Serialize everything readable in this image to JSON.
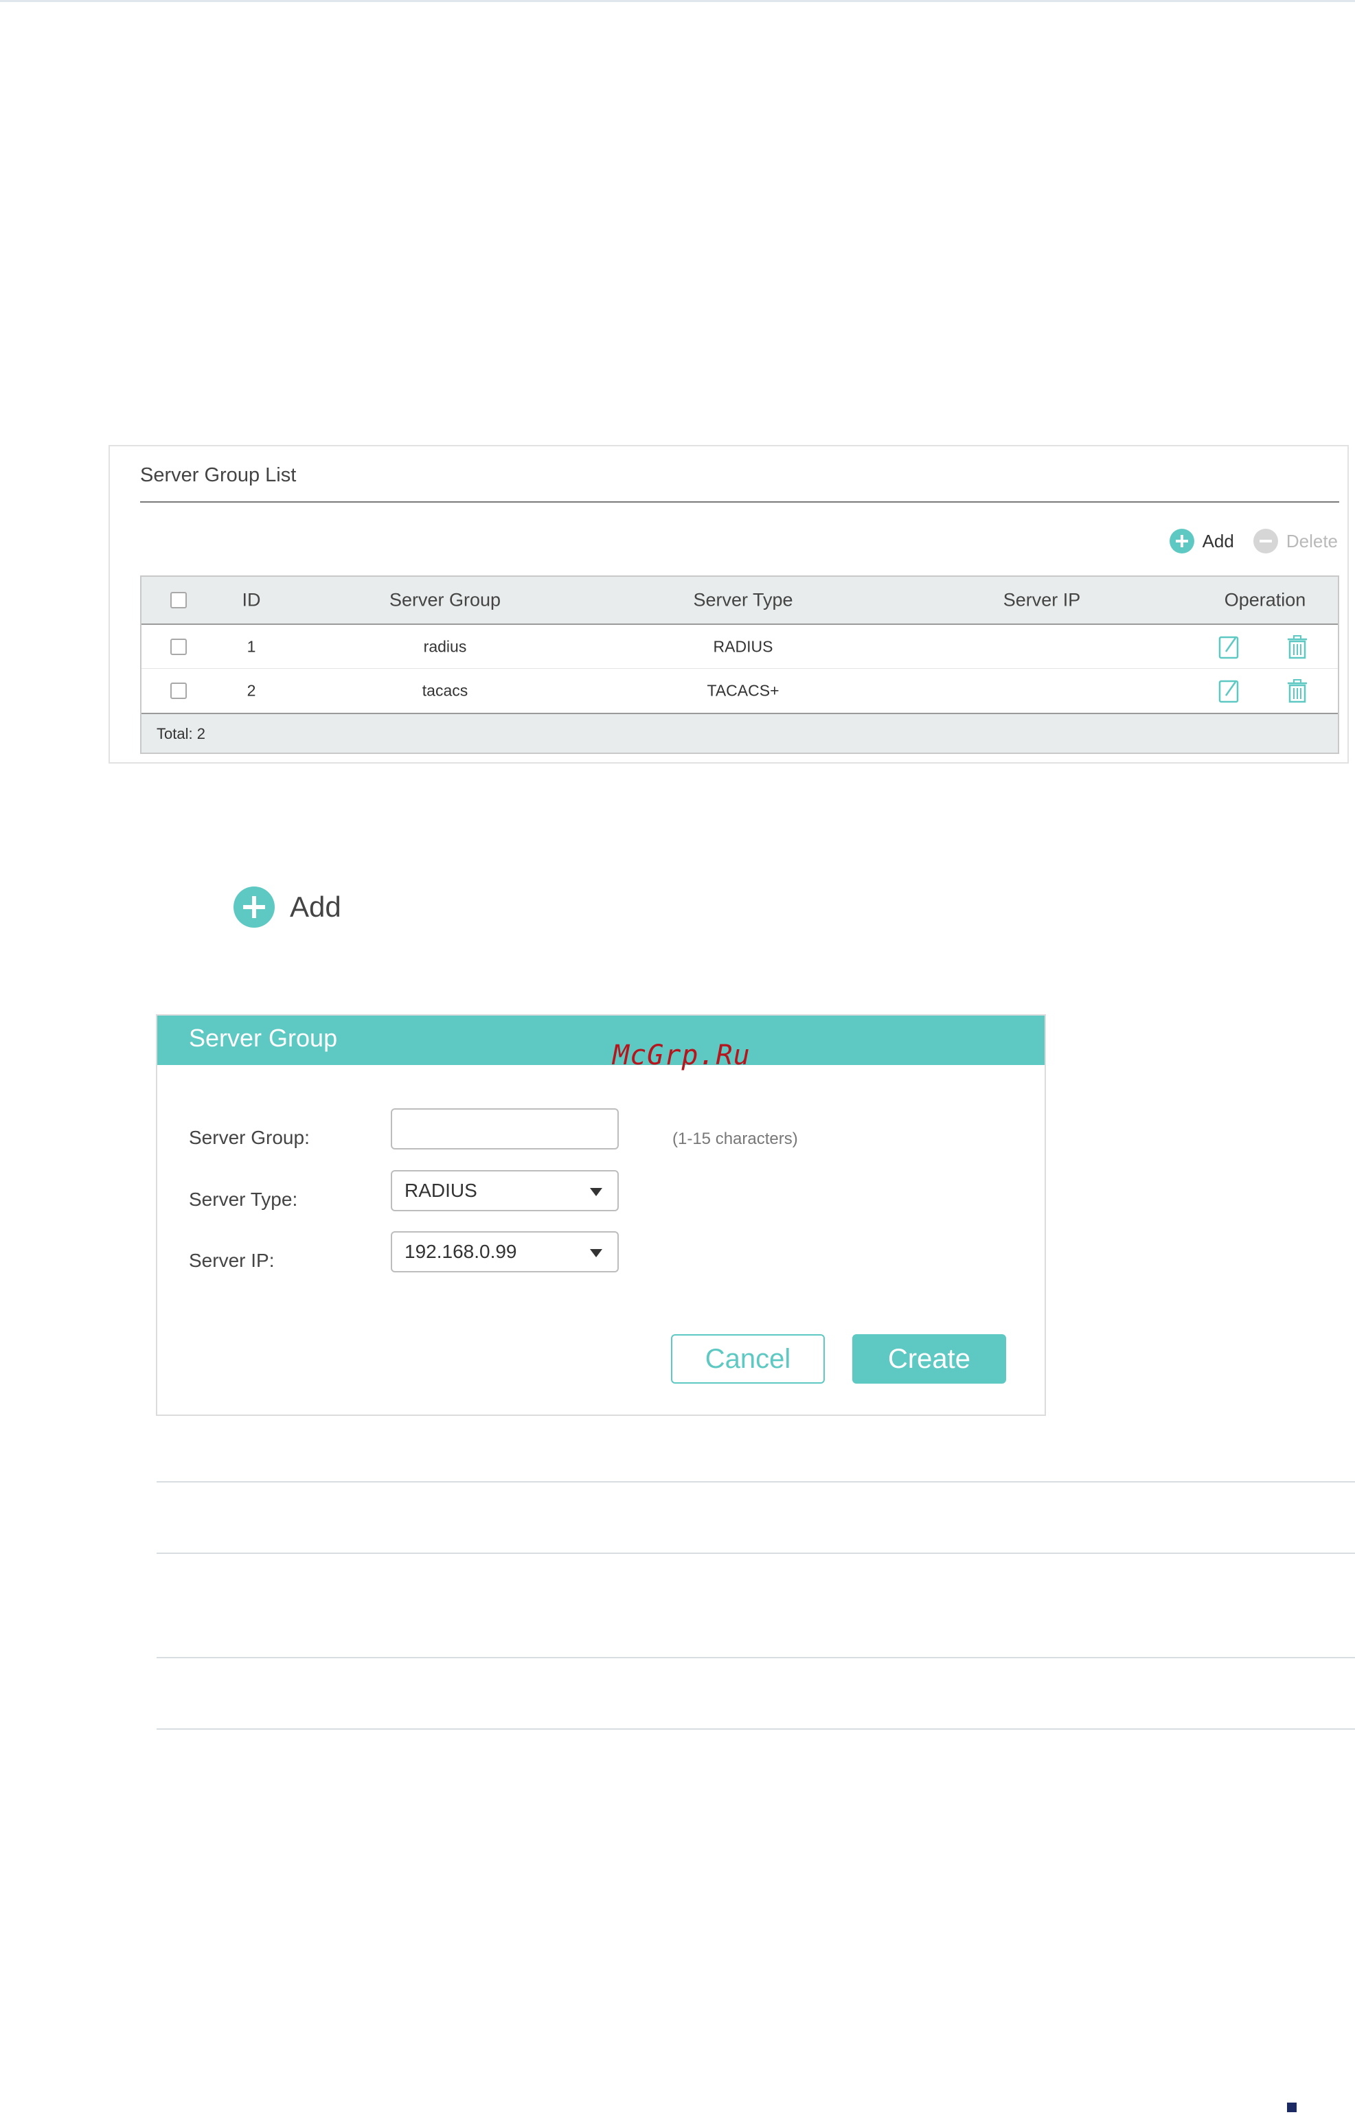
{
  "server_group_list": {
    "title": "Server Group List",
    "toolbar": {
      "add_label": "Add",
      "delete_label": "Delete"
    },
    "columns": [
      "",
      "ID",
      "Server Group",
      "Server Type",
      "Server IP",
      "Operation"
    ],
    "rows": [
      {
        "id": "1",
        "server_group": "radius",
        "server_type": "RADIUS",
        "server_ip": ""
      },
      {
        "id": "2",
        "server_group": "tacacs",
        "server_type": "TACACS+",
        "server_ip": ""
      }
    ],
    "footer": "Total: 2"
  },
  "add_button": {
    "label": "Add"
  },
  "dialog": {
    "title": "Server Group",
    "fields": {
      "server_group": {
        "label": "Server Group:",
        "value": "",
        "hint": "(1-15 characters)"
      },
      "server_type": {
        "label": "Server Type:",
        "value": "RADIUS"
      },
      "server_ip": {
        "label": "Server IP:",
        "value": "192.168.0.99"
      }
    },
    "buttons": {
      "cancel": "Cancel",
      "create": "Create"
    }
  },
  "watermark": "McGrp.Ru",
  "colors": {
    "accent": "#5ec9c3",
    "watermark": "#b5161d"
  }
}
